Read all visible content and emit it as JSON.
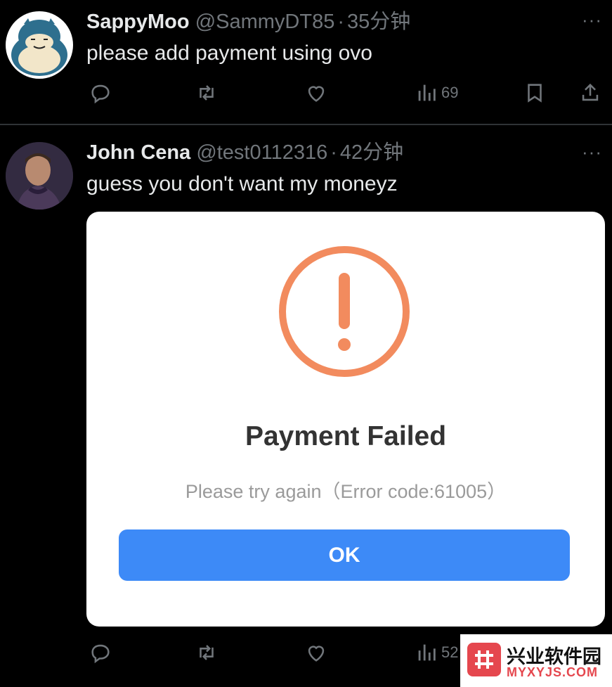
{
  "tweets": [
    {
      "name": "SappyMoo",
      "handle": "@SammyDT85",
      "separator": "·",
      "time": "35分钟",
      "more": "···",
      "text": "please add payment using ovo",
      "actions": {
        "views": "69"
      }
    },
    {
      "name": "John Cena",
      "handle": "@test0112316",
      "separator": "·",
      "time": "42分钟",
      "more": "···",
      "text": "guess you don't want my moneyz",
      "actions": {
        "views": "52"
      },
      "media": {
        "title": "Payment Failed",
        "message": "Please try again（Error code:61005）",
        "button": "OK",
        "warning_color": "#f28b5e",
        "button_color": "#3d8af7"
      }
    }
  ],
  "watermark": {
    "title": "兴业软件园",
    "url": "MYXYJS.COM"
  },
  "icons": [
    "reply-icon",
    "retweet-icon",
    "like-icon",
    "views-icon",
    "bookmark-icon",
    "share-icon",
    "more-icon",
    "warning-icon"
  ]
}
